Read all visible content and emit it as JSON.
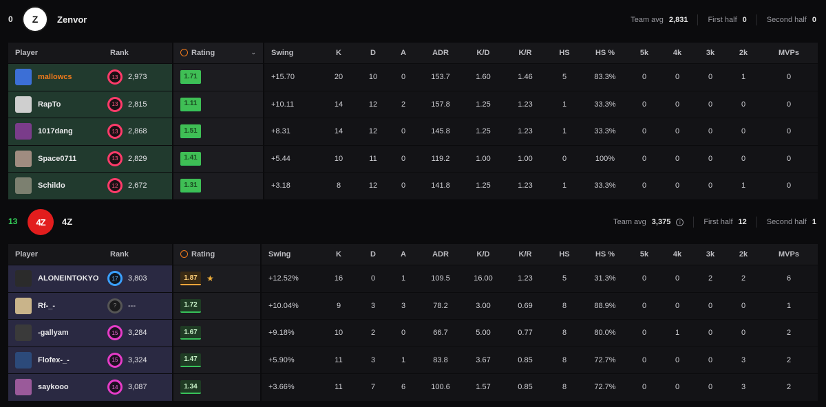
{
  "team1": {
    "score": "0",
    "name": "Zenvor",
    "logo_text": "Z",
    "team_avg_label": "Team avg",
    "team_avg": "2,831",
    "first_half_label": "First half",
    "first_half": "0",
    "second_half_label": "Second half",
    "second_half": "0",
    "players": [
      {
        "name": "mallowcs",
        "rank_tier": "13",
        "rank": "2,973",
        "rating": "1.71",
        "swing": "+15.70",
        "k": "20",
        "d": "10",
        "a": "0",
        "adr": "153.7",
        "kd": "1.60",
        "kr": "1.46",
        "hs": "5",
        "hsp": "83.3%",
        "k5": "0",
        "k4": "0",
        "k3": "0",
        "k2": "1",
        "mvps": "0",
        "avatar": "#3c6fd6"
      },
      {
        "name": "RapTo",
        "rank_tier": "13",
        "rank": "2,815",
        "rating": "1.11",
        "swing": "+10.11",
        "k": "14",
        "d": "12",
        "a": "2",
        "adr": "157.8",
        "kd": "1.25",
        "kr": "1.23",
        "hs": "1",
        "hsp": "33.3%",
        "k5": "0",
        "k4": "0",
        "k3": "0",
        "k2": "0",
        "mvps": "0",
        "avatar": "#cfcfcf"
      },
      {
        "name": "1017dang",
        "rank_tier": "13",
        "rank": "2,868",
        "rating": "1.51",
        "swing": "+8.31",
        "k": "14",
        "d": "12",
        "a": "0",
        "adr": "145.8",
        "kd": "1.25",
        "kr": "1.23",
        "hs": "1",
        "hsp": "33.3%",
        "k5": "0",
        "k4": "0",
        "k3": "0",
        "k2": "0",
        "mvps": "0",
        "avatar": "#7a3c8a"
      },
      {
        "name": "Space0711",
        "rank_tier": "13",
        "rank": "2,829",
        "rating": "1.41",
        "swing": "+5.44",
        "k": "10",
        "d": "11",
        "a": "0",
        "adr": "119.2",
        "kd": "1.00",
        "kr": "1.00",
        "hs": "0",
        "hsp": "100%",
        "k5": "0",
        "k4": "0",
        "k3": "0",
        "k2": "0",
        "mvps": "0",
        "avatar": "#a08c80"
      },
      {
        "name": "Schildo",
        "rank_tier": "12",
        "rank": "2,672",
        "rating": "1.31",
        "swing": "+3.18",
        "k": "8",
        "d": "12",
        "a": "0",
        "adr": "141.8",
        "kd": "1.25",
        "kr": "1.23",
        "hs": "1",
        "hsp": "33.3%",
        "k5": "0",
        "k4": "0",
        "k3": "0",
        "k2": "1",
        "mvps": "0",
        "avatar": "#7c8070"
      }
    ]
  },
  "team2": {
    "score": "13",
    "name": "4Z",
    "logo_text": "4Z",
    "team_avg_label": "Team avg",
    "team_avg": "3,375",
    "first_half_label": "First half",
    "first_half": "12",
    "second_half_label": "Second half",
    "second_half": "1",
    "players": [
      {
        "name": "ALONEINTOKYO",
        "rank_tier": "17",
        "rank": "3,803",
        "rating": "1.87",
        "swing": "+12.52%",
        "k": "16",
        "d": "0",
        "a": "1",
        "adr": "109.5",
        "kd": "16.00",
        "kr": "1.23",
        "hs": "5",
        "hsp": "31.3%",
        "k5": "0",
        "k4": "0",
        "k3": "2",
        "k2": "2",
        "mvps": "6",
        "avatar": "#2b2b2b"
      },
      {
        "name": "Rf-_-",
        "rank_tier": "?",
        "rank": "---",
        "rating": "1.72",
        "swing": "+10.04%",
        "k": "9",
        "d": "3",
        "a": "3",
        "adr": "78.2",
        "kd": "3.00",
        "kr": "0.69",
        "hs": "8",
        "hsp": "88.9%",
        "k5": "0",
        "k4": "0",
        "k3": "0",
        "k2": "0",
        "mvps": "1",
        "avatar": "#c9b48a"
      },
      {
        "name": "-gallyam",
        "rank_tier": "15",
        "rank": "3,284",
        "rating": "1.67",
        "swing": "+9.18%",
        "k": "10",
        "d": "2",
        "a": "0",
        "adr": "66.7",
        "kd": "5.00",
        "kr": "0.77",
        "hs": "8",
        "hsp": "80.0%",
        "k5": "0",
        "k4": "1",
        "k3": "0",
        "k2": "0",
        "mvps": "2",
        "avatar": "#3a3a3a"
      },
      {
        "name": "Flofex-_-",
        "rank_tier": "15",
        "rank": "3,324",
        "rating": "1.47",
        "swing": "+5.90%",
        "k": "11",
        "d": "3",
        "a": "1",
        "adr": "83.8",
        "kd": "3.67",
        "kr": "0.85",
        "hs": "8",
        "hsp": "72.7%",
        "k5": "0",
        "k4": "0",
        "k3": "0",
        "k2": "3",
        "mvps": "2",
        "avatar": "#2c4a7a"
      },
      {
        "name": "saykooo",
        "rank_tier": "14",
        "rank": "3,087",
        "rating": "1.34",
        "swing": "+3.66%",
        "k": "11",
        "d": "7",
        "a": "6",
        "adr": "100.6",
        "kd": "1.57",
        "kr": "0.85",
        "hs": "8",
        "hsp": "72.7%",
        "k5": "0",
        "k4": "0",
        "k3": "0",
        "k2": "3",
        "mvps": "2",
        "avatar": "#9a5a9a"
      }
    ]
  },
  "columns": {
    "player": "Player",
    "rank": "Rank",
    "rating": "Rating",
    "swing": "Swing",
    "k": "K",
    "d": "D",
    "a": "A",
    "adr": "ADR",
    "kd": "K/D",
    "kr": "K/R",
    "hs": "HS",
    "hsp": "HS %",
    "k5": "5k",
    "k4": "4k",
    "k3": "3k",
    "k2": "2k",
    "mvps": "MVPs"
  },
  "accent": "#f07a1c"
}
